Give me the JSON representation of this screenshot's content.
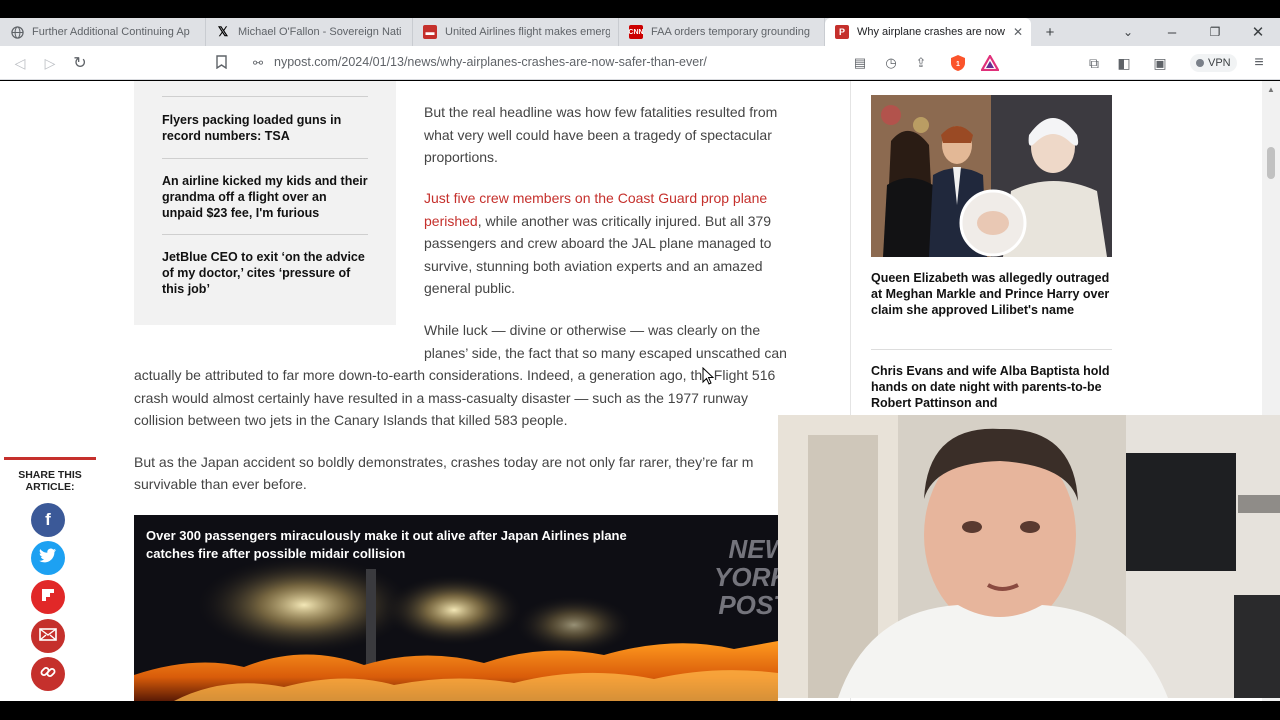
{
  "tabs": [
    {
      "title": "Further Additional Continuing Ap",
      "favicon": "globe-icon",
      "color": "#5f6368"
    },
    {
      "title": "Michael O'Fallon - Sovereign Nati",
      "favicon": "x-logo-icon",
      "color": "#000000"
    },
    {
      "title": "United Airlines flight makes emerg",
      "favicon": "news-icon",
      "color": "#c5302c"
    },
    {
      "title": "FAA orders temporary grounding",
      "favicon": "cnn-icon",
      "color": "#cc0000"
    },
    {
      "title": "Why airplane crashes are now",
      "favicon": "nypost-icon",
      "color": "#c5302c",
      "active": true
    }
  ],
  "address": {
    "url": "nypost.com/2024/01/13/news/why-airplanes-crashes-are-now-safer-than-ever/"
  },
  "toolbar": {
    "vpn_label": "VPN"
  },
  "related": [
    "Flyers packing loaded guns in record numbers: TSA",
    "An airline kicked my kids and their grandma off a flight over an unpaid $23 fee, I'm furious",
    "JetBlue CEO to exit ‘on the advice of my doctor,’ cites ‘pressure of this job’"
  ],
  "article": {
    "p1": "But the real headline was how few fatalities resulted from what very well could have been a tragedy of spectacular proportions.",
    "p2_link": "Just five crew members on the Coast Guard prop plane perished",
    "p2_rest": ", while another was critically injured. But all 379 passengers and crew aboard the JAL plane managed to survive, stunning both aviation experts and an amazed general public.",
    "p3_line1": "While luck — divine or otherwise — was clearly on the",
    "p3_line2": "planes’ side, the fact that so many escaped unscathed can",
    "p3_line3": "actually be attributed to far more down-to-earth considerations. Indeed, a generation ago, the Flight 516",
    "p3_line4": "crash would almost certainly have resulted in a mass-casualty disaster — such as the 1977 runway",
    "p3_line5": "collision between two jets in the Canary Islands that killed 583 people.",
    "p4_line1": "But as the Japan accident so boldly demonstrates, crashes today are not only far rarer, they’re far m",
    "p4_line2": "survivable than ever before."
  },
  "share": {
    "label_line1": "SHARE THIS",
    "label_line2": "ARTICLE:",
    "buttons": [
      {
        "name": "facebook-share-button",
        "glyph": "f",
        "color": "#3b5998"
      },
      {
        "name": "twitter-share-button",
        "glyph": "•",
        "color": "#1da1f2"
      },
      {
        "name": "flipboard-share-button",
        "glyph": "F",
        "color": "#e12828"
      },
      {
        "name": "email-share-button",
        "glyph": "✉",
        "color": "#c5302c"
      },
      {
        "name": "copy-link-share-button",
        "glyph": "∞",
        "color": "#c5302c"
      }
    ]
  },
  "video": {
    "title": "Over 300 passengers miraculously make it out alive after Japan Airlines plane catches fire after possible midair collision",
    "logo_line1": "NEW",
    "logo_line2": "YORK",
    "logo_line3": "POST"
  },
  "sidebar": {
    "stories": [
      "Queen Elizabeth was allegedly outraged at Meghan Markle and Prince Harry over claim she approved Lilibet's name",
      "Chris Evans and wife Alba Baptista hold hands on date night with parents-to-be Robert Pattinson and"
    ]
  }
}
